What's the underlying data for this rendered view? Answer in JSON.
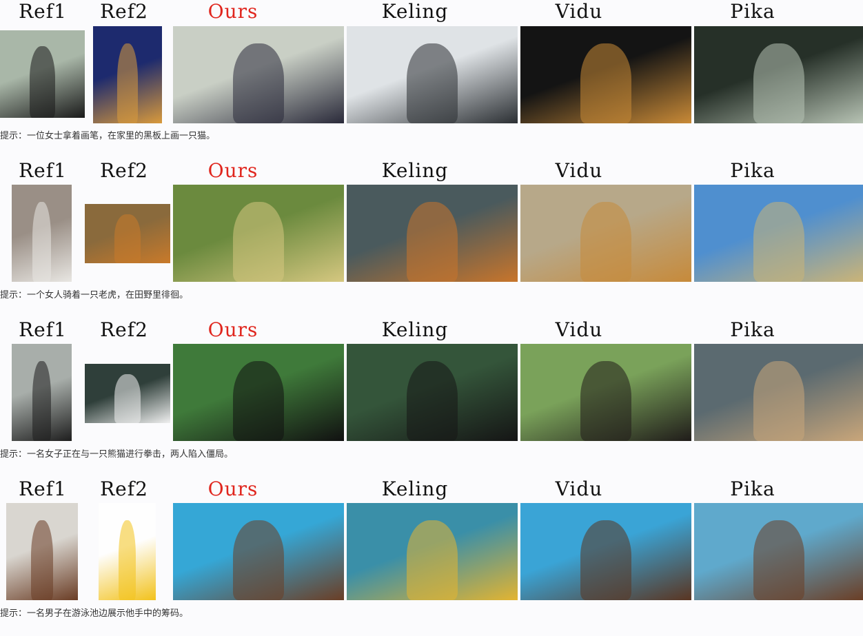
{
  "headers": [
    "Ref1",
    "Ref2",
    "Ours",
    "Keling",
    "Vidu",
    "Pika"
  ],
  "rows": [
    {
      "prompt": "提示：一位女士拿着画笔，在家里的黑板上画一只猫。",
      "images": [
        {
          "name": "ref1-woman-portrait",
          "colors": [
            "#a9b7a8",
            "#1a1a1a"
          ]
        },
        {
          "name": "ref2-persian-cat",
          "colors": [
            "#1d2a6e",
            "#d99a3c"
          ]
        },
        {
          "name": "ours-woman-painting-cat",
          "colors": [
            "#c9cfc5",
            "#2a2a3a"
          ]
        },
        {
          "name": "keling-woman-chalkboard",
          "colors": [
            "#dfe3e6",
            "#2b2f33"
          ]
        },
        {
          "name": "vidu-woman-painting-cat",
          "colors": [
            "#141414",
            "#c98a37"
          ]
        },
        {
          "name": "pika-chalkboard-cat-drawing",
          "colors": [
            "#263028",
            "#b7c3b4"
          ]
        }
      ]
    },
    {
      "prompt": "提示：一个女人骑着一只老虎，在田野里徘徊。",
      "images": [
        {
          "name": "ref1-young-woman",
          "colors": [
            "#9a8f86",
            "#e8e6e2"
          ]
        },
        {
          "name": "ref2-tiger",
          "colors": [
            "#8a6a3c",
            "#c97a2a"
          ]
        },
        {
          "name": "ours-woman-riding-tiger",
          "colors": [
            "#6b8a3e",
            "#d5c780"
          ]
        },
        {
          "name": "keling-woman-riding-tiger",
          "colors": [
            "#4a5a5d",
            "#c8752b"
          ]
        },
        {
          "name": "vidu-woman-riding-tiger",
          "colors": [
            "#b7a889",
            "#c78a3a"
          ]
        },
        {
          "name": "pika-woman-riding-tiger",
          "colors": [
            "#4f8fcf",
            "#cbb477"
          ]
        }
      ]
    },
    {
      "prompt": "提示：一名女子正在与一只熊猫进行拳击，两人陷入僵局。",
      "images": [
        {
          "name": "ref1-athletic-woman",
          "colors": [
            "#a8aeaa",
            "#1e1e1e"
          ]
        },
        {
          "name": "ref2-panda",
          "colors": [
            "#2f3f3a",
            "#f0f0f0"
          ]
        },
        {
          "name": "ours-woman-boxing-panda",
          "colors": [
            "#3f7a3a",
            "#111111"
          ]
        },
        {
          "name": "keling-woman-boxing-panda",
          "colors": [
            "#34553a",
            "#151515"
          ]
        },
        {
          "name": "vidu-woman-boxing-panda",
          "colors": [
            "#7aa25a",
            "#201c1a"
          ]
        },
        {
          "name": "pika-woman-boxing-panda",
          "colors": [
            "#5b6a70",
            "#c9a67a"
          ]
        }
      ]
    },
    {
      "prompt": "提示：一名男子在游泳池边展示他手中的筹码。",
      "images": [
        {
          "name": "ref1-man-portrait",
          "colors": [
            "#d9d6d0",
            "#6a3c24"
          ]
        },
        {
          "name": "ref2-lays-chips-bag",
          "colors": [
            "#fefefe",
            "#f2c21c"
          ]
        },
        {
          "name": "ours-man-pool-chips",
          "colors": [
            "#35a7d6",
            "#6b3e25"
          ]
        },
        {
          "name": "keling-man-pool-chips",
          "colors": [
            "#3a8fa8",
            "#e3b431"
          ]
        },
        {
          "name": "vidu-man-pool-chips",
          "colors": [
            "#3aa4d6",
            "#5a3521"
          ]
        },
        {
          "name": "pika-man-pool-chips",
          "colors": [
            "#5fa9cc",
            "#6b3e25"
          ]
        }
      ]
    }
  ]
}
